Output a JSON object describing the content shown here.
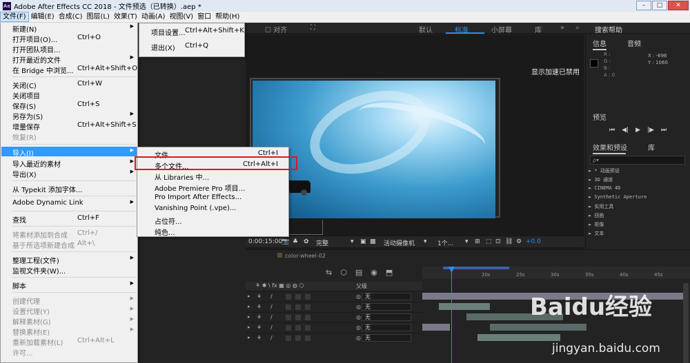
{
  "window": {
    "app_icon": "Ae",
    "title": "Adobe After Effects CC 2018 - 文件预选（已转换）.aep *",
    "btn_min": "–",
    "btn_max": "□",
    "btn_close": "✕"
  },
  "menubar": [
    "文件(F)",
    "编辑(E)",
    "合成(C)",
    "图层(L)",
    "效果(T)",
    "动画(A)",
    "视图(V)",
    "窗口",
    "帮助(H)"
  ],
  "toolbar": {
    "snap": "对齐",
    "ws_default": "默认",
    "ws_standard": "标准",
    "ws_small": "小屏幕",
    "ws_library": "库",
    "more": "»",
    "search": "搜索帮助"
  },
  "file_menu": [
    {
      "label": "新建(N)",
      "shortcut": "",
      "arrow": true,
      "disabled": false
    },
    {
      "label": "打开项目(O)...",
      "shortcut": "Ctrl+O",
      "arrow": false,
      "disabled": false
    },
    {
      "label": "打开团队项目...",
      "shortcut": "",
      "arrow": false,
      "disabled": false
    },
    {
      "label": "打开最近的文件",
      "shortcut": "",
      "arrow": true,
      "disabled": false
    },
    {
      "label": "在 Bridge 中浏览...",
      "shortcut": "Ctrl+Alt+Shift+O",
      "arrow": false,
      "disabled": false
    },
    {
      "label": "关闭(C)",
      "shortcut": "Ctrl+W",
      "arrow": false,
      "disabled": false
    },
    {
      "label": "关闭项目",
      "shortcut": "",
      "arrow": false,
      "disabled": false
    },
    {
      "label": "保存(S)",
      "shortcut": "Ctrl+S",
      "arrow": false,
      "disabled": false
    },
    {
      "label": "另存为(S)",
      "shortcut": "",
      "arrow": true,
      "disabled": false
    },
    {
      "label": "增量保存",
      "shortcut": "Ctrl+Alt+Shift+S",
      "arrow": false,
      "disabled": false
    },
    {
      "label": "恢复(R)",
      "shortcut": "",
      "arrow": false,
      "disabled": true
    },
    {
      "label": "导入(I)",
      "shortcut": "",
      "arrow": true,
      "disabled": false,
      "highlight": true
    },
    {
      "label": "导入最近的素材",
      "shortcut": "",
      "arrow": true,
      "disabled": false
    },
    {
      "label": "导出(X)",
      "shortcut": "",
      "arrow": true,
      "disabled": false
    },
    {
      "label": "从 Typekit 添加字体...",
      "shortcut": "",
      "arrow": false,
      "disabled": false
    },
    {
      "label": "Adobe Dynamic Link",
      "shortcut": "",
      "arrow": true,
      "disabled": false
    },
    {
      "label": "查找",
      "shortcut": "Ctrl+F",
      "arrow": false,
      "disabled": false
    },
    {
      "label": "将素材添加到合成",
      "shortcut": "Ctrl+/",
      "arrow": false,
      "disabled": true
    },
    {
      "label": "基于所选项新建合成",
      "shortcut": "Alt+\\",
      "arrow": false,
      "disabled": true
    },
    {
      "label": "整理工程(文件)",
      "shortcut": "",
      "arrow": true,
      "disabled": false
    },
    {
      "label": "监视文件夹(W)...",
      "shortcut": "",
      "arrow": false,
      "disabled": false
    },
    {
      "label": "脚本",
      "shortcut": "",
      "arrow": true,
      "disabled": false
    },
    {
      "label": "创建代理",
      "shortcut": "",
      "arrow": true,
      "disabled": true
    },
    {
      "label": "设置代理(Y)",
      "shortcut": "",
      "arrow": true,
      "disabled": true
    },
    {
      "label": "解释素材(G)",
      "shortcut": "",
      "arrow": true,
      "disabled": true
    },
    {
      "label": "替换素材(E)",
      "shortcut": "",
      "arrow": true,
      "disabled": true
    },
    {
      "label": "重新加载素材(L)",
      "shortcut": "Ctrl+Alt+L",
      "arrow": false,
      "disabled": true
    },
    {
      "label": "许可...",
      "shortcut": "",
      "arrow": false,
      "disabled": true
    }
  ],
  "edit_submenu": [
    {
      "label": "项目设置...",
      "shortcut": "Ctrl+Alt+Shift+K"
    },
    {
      "label": "退出(X)",
      "shortcut": "Ctrl+Q"
    }
  ],
  "import_submenu": [
    {
      "label": "文件...",
      "shortcut": "Ctrl+I"
    },
    {
      "label": "多个文件...",
      "shortcut": "Ctrl+Alt+I"
    },
    {
      "label": "从 Libraries 中...",
      "shortcut": ""
    },
    {
      "label": "Adobe Premiere Pro 项目...",
      "shortcut": ""
    },
    {
      "label": "Pro Import After Effects...",
      "shortcut": ""
    },
    {
      "label": "Vanishing Point (.vpe)...",
      "shortcut": ""
    },
    {
      "label": "占位符...",
      "shortcut": ""
    },
    {
      "label": "纯色...",
      "shortcut": ""
    }
  ],
  "comp": {
    "accel_text": "显示加速已禁用",
    "time": "0:00:15:00",
    "quality": "完整",
    "camera": "活动摄像机",
    "views": "1个...",
    "offset": "+0.0"
  },
  "right_panel": {
    "tab_info": "信息",
    "tab_audio": "音频",
    "rgba": [
      "R :",
      "G :",
      "B :",
      "A : 0"
    ],
    "x": "X : -696",
    "y": "Y : 1060",
    "preview_title": "预览",
    "preview_ctrls": [
      "⏮",
      "◀|",
      "▶",
      "|▶",
      "⏭"
    ],
    "fx_tab": "效果和预设",
    "lib_tab": "库",
    "fx_search": "ρ▾",
    "fx_items": [
      "► * 动画预设",
      "► 3D 通道",
      "► CINEMA 4D",
      "► Synthetic Aperture",
      "► 实用工具",
      "► 扭曲",
      "► 抠像",
      "► 文本"
    ]
  },
  "timeline": {
    "comp_name": "color-wheel-02",
    "ruler_ticks": [
      "20s",
      "25s",
      "30s",
      "35s",
      "40s",
      "45s"
    ],
    "parent_header": "父级",
    "rows": [
      {
        "parent": "无"
      },
      {
        "parent": "无"
      },
      {
        "parent": "无"
      },
      {
        "parent": "无"
      },
      {
        "parent": "无"
      }
    ]
  },
  "watermark": {
    "logo": "Baidu经验",
    "url": "jingyan.baidu.com"
  },
  "colors": {
    "accent": "#2d8ceb",
    "menu_highlight": "#3399ff",
    "red_box": "#e0161e"
  }
}
